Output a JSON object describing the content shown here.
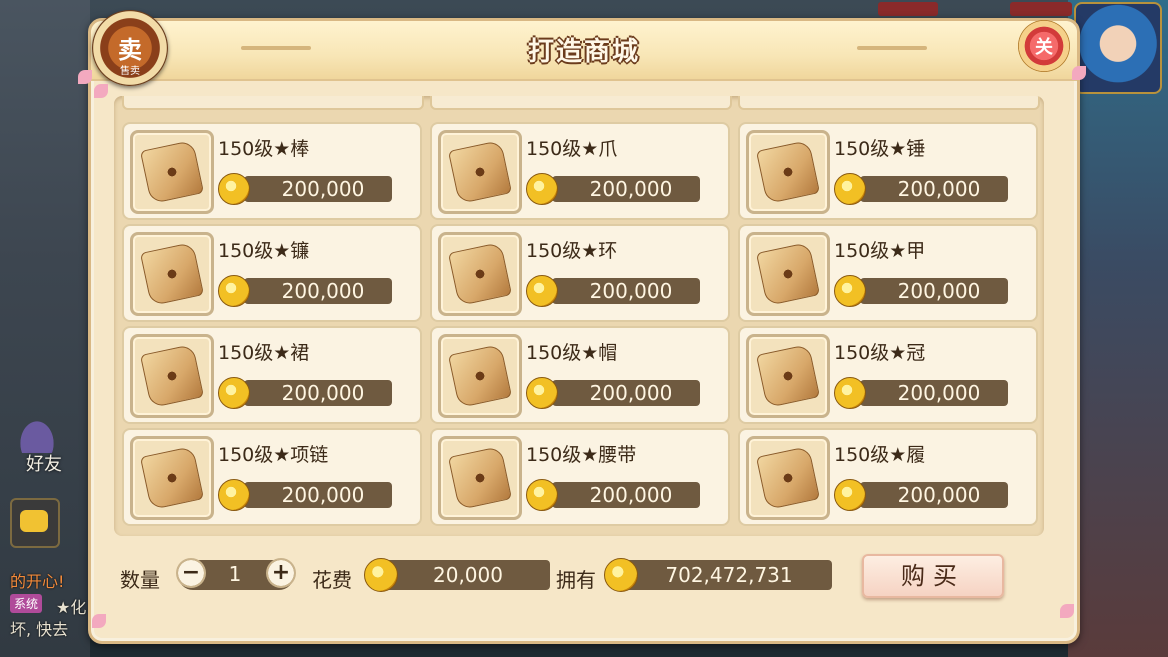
{
  "window": {
    "title": "打造商城"
  },
  "background": {
    "friend_label": "好友",
    "chat_lines": [
      "的开心!",
      "★化",
      "坏, 快去"
    ],
    "chat_tag": "系统"
  },
  "badges": {
    "sell_symbol": "卖",
    "sell_label": "售卖",
    "close_symbol": "关"
  },
  "items": [
    {
      "name": "150级★棒",
      "price": "200,000"
    },
    {
      "name": "150级★爪",
      "price": "200,000"
    },
    {
      "name": "150级★锤",
      "price": "200,000"
    },
    {
      "name": "150级★镰",
      "price": "200,000"
    },
    {
      "name": "150级★环",
      "price": "200,000"
    },
    {
      "name": "150级★甲",
      "price": "200,000"
    },
    {
      "name": "150级★裙",
      "price": "200,000"
    },
    {
      "name": "150级★帽",
      "price": "200,000"
    },
    {
      "name": "150级★冠",
      "price": "200,000"
    },
    {
      "name": "150级★项链",
      "price": "200,000"
    },
    {
      "name": "150级★腰带",
      "price": "200,000"
    },
    {
      "name": "150级★履",
      "price": "200,000"
    }
  ],
  "footer": {
    "quantity_label": "数量",
    "minus": "−",
    "plus": "+",
    "quantity": "1",
    "cost_label": "花费",
    "cost": "20,000",
    "owned_label": "拥有",
    "owned": "702,472,731",
    "buy_label": "购买"
  },
  "icons": [
    "sell-icon",
    "close-icon",
    "scroll-icon",
    "coin-icon",
    "minus-icon",
    "plus-icon",
    "chat-icon"
  ]
}
